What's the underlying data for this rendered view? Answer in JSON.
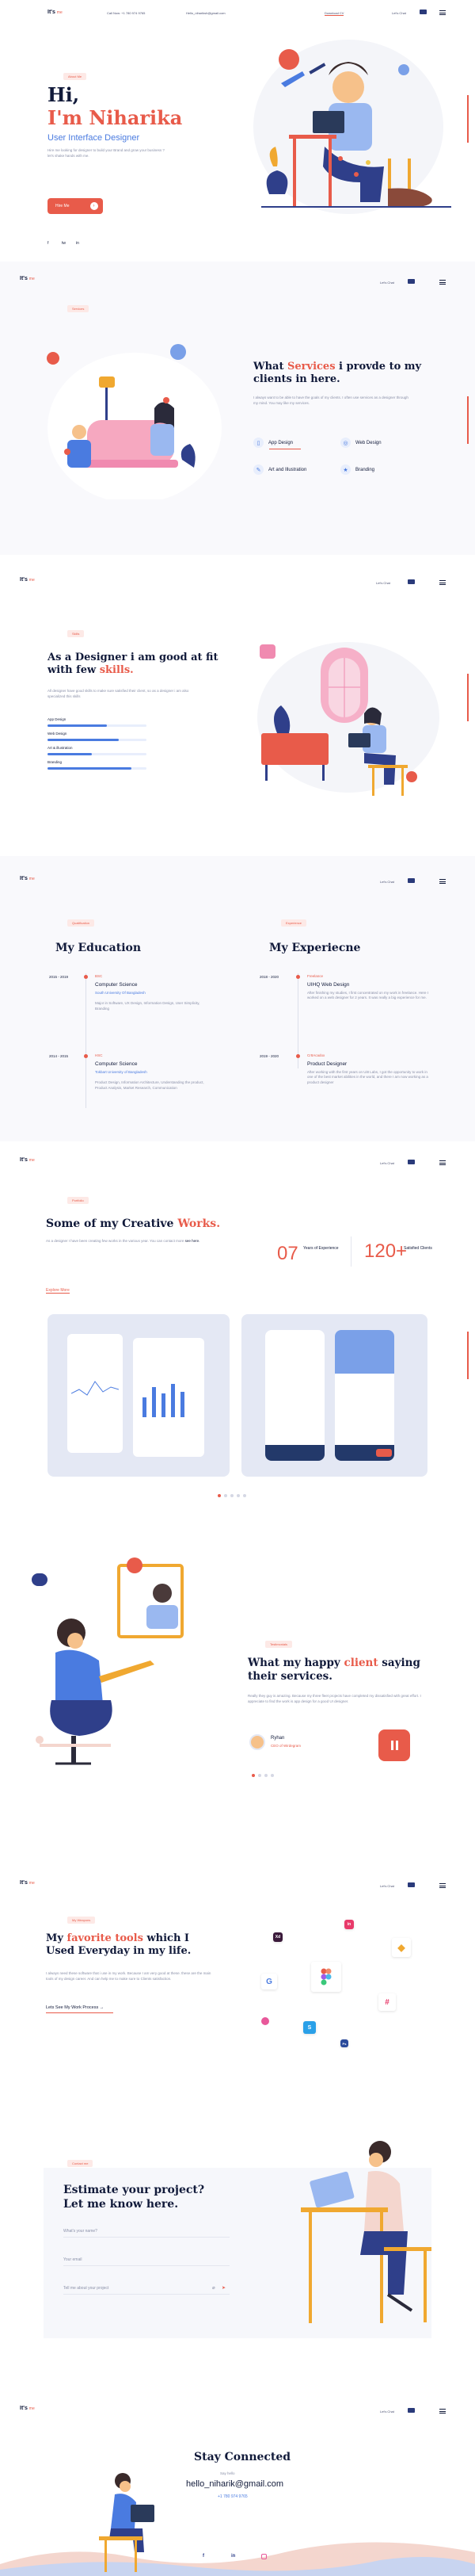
{
  "brand": {
    "logo": "It's",
    "logo_sub": "me"
  },
  "hero": {
    "phone": "Call Now: +1 780 974 9765",
    "email": "Hello_nihariksh@gmail.com",
    "download": "Download CV",
    "lang": "Let's Chat",
    "hi": "Hi,",
    "name": "I'm Niharika",
    "role": "User Interface Designer",
    "pill": "About Me",
    "desc": "Hire me looking for designer to build your Brand and grow your business ? let's shake hands with me.",
    "cta": "Hire Me",
    "socials": [
      "f",
      "tw",
      "in"
    ]
  },
  "nav_chat": "Let's Chat",
  "services": {
    "pill": "Services",
    "title_a": "What ",
    "title_acc": "Services",
    "title_b": " i provde to my clients in here.",
    "desc": "I always want to be able to have the goals of my clients. I often use services as a designer through my mind. You may like my services.",
    "items": [
      "App Design",
      "Web Design",
      "Art and Illustration",
      "Branding"
    ],
    "icons": [
      "phone-icon",
      "globe-icon",
      "brush-icon",
      "star-icon"
    ]
  },
  "skills": {
    "pill": "Skills",
    "title_a": "As a Designer i am good at fit with few ",
    "title_acc": "skills.",
    "desc": "All designer have good skills to make sure satisfied their client, so as a designer i am also specialized this skills",
    "list": [
      {
        "name": "App Design",
        "level": 0.6
      },
      {
        "name": "Web Design",
        "level": 0.72
      },
      {
        "name": "Art & illustration",
        "level": 0.45
      },
      {
        "name": "Branding",
        "level": 0.85
      }
    ]
  },
  "resume": {
    "pill_q": "Qualification",
    "pill_e": "Experience",
    "edu_title": "My Education",
    "exp_title": "My Experiecne",
    "edu": [
      {
        "years": "2015 - 2019",
        "tag": "BSC",
        "title": "Computer Science",
        "place": "South University Of Bangladesh",
        "desc": "Major in Software, UX Design, Information Design, User Simplicity, Branding"
      },
      {
        "years": "2014 - 2015",
        "tag": "HSC",
        "title": "Computer Science",
        "place": "Tokbart University of Bangladesh",
        "desc": "Product Design, Information Architecture, Understanding the product, Product Analysis, Market Research, Communication"
      }
    ],
    "exp": [
      {
        "years": "2018 - 2020",
        "tag": "Freelance",
        "title": "UIHQ Web Design",
        "desc": "After finishing my studies, I first concentrated on my work in freelance. Here I worked on a web designer for 2 years. It was really a big experience for me."
      },
      {
        "years": "2019 - 2020",
        "tag": "Cr8Acadox",
        "title": "Product Designer",
        "desc": "After working with the first years on Ui8 Labs, I got the opportunity to work in one of the best market abilities in the world, and there I am now working as a product designer"
      }
    ]
  },
  "works": {
    "pill": "Portfolio",
    "title_a": "Some of my Creative ",
    "title_acc": "Works.",
    "desc": "As a designer I have been creating few works in the various year. You can contact more ",
    "desc_link": "see here.",
    "stat1_num": "07",
    "stat1_label": "Years of Experience",
    "stat2_num": "120+",
    "stat2_label": "Satisfied Clients",
    "explore": "Explore More"
  },
  "testimonial": {
    "pill": "Testimonials",
    "title_a": "What my happy ",
    "title_acc": "client",
    "title_b": " saying their services.",
    "quote": "Really they guy is amazing. Because my three fleet projects have completed my dissatisfied with great effort. I appreciate to find the work is app design for a good UI designer.",
    "name": "Ryhan",
    "role": "CEO of Wirdegram"
  },
  "tools": {
    "pill": "My Weapons",
    "title_a": "My ",
    "title_acc": "favorite tools",
    "title_b": " which I Used Everyday in my life.",
    "desc": "I always need these software that i use in my work. Because I am very good at these. these are the main tools of my design career. And can help me to make sure to Clients satisfaction.",
    "link": "Lets See My Work Process →"
  },
  "contact": {
    "pill": "Contact me",
    "title": "Estimate your project? Let me know here.",
    "name_ph": "What's your name?",
    "email_ph": "Your email",
    "msg_ph": "Tell me about your project"
  },
  "footer": {
    "title": "Stay Connected",
    "say": "Say hello",
    "email": "hello_niharik@gmail.com",
    "phone": "+1 780 974 9765"
  },
  "colors": {
    "accent": "#e85b4a",
    "blue": "#4a7be0",
    "navy": "#111a3a"
  }
}
